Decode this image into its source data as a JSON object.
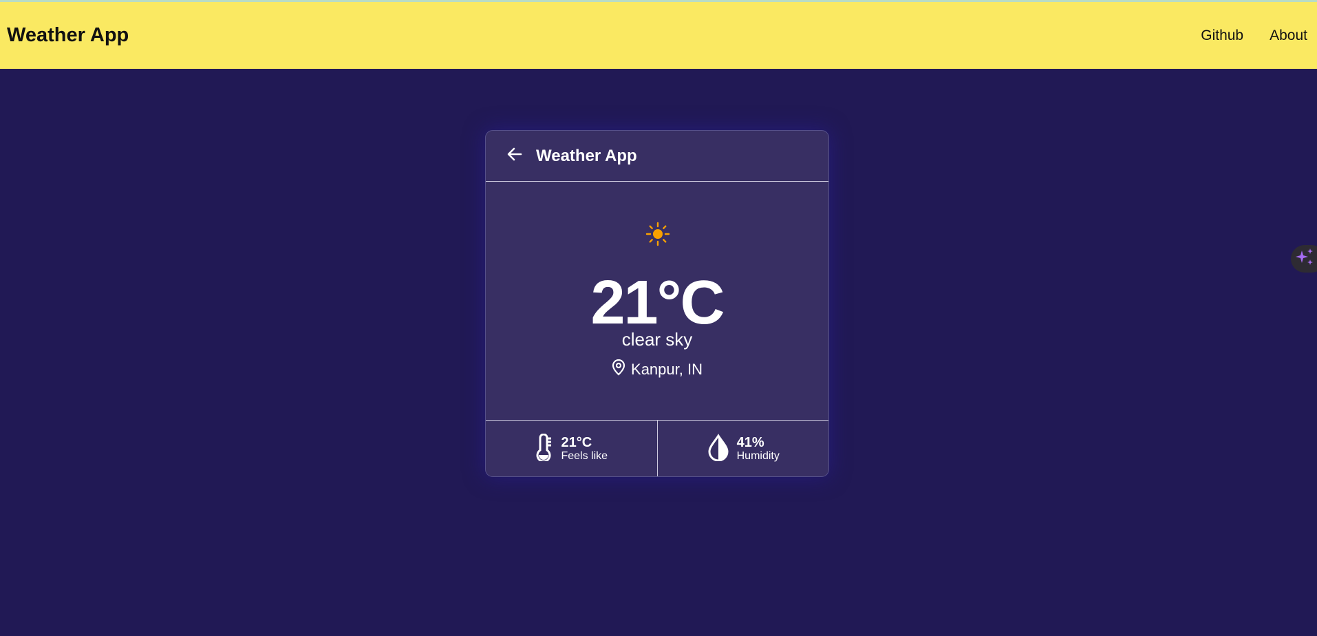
{
  "navbar": {
    "title": "Weather App",
    "links": [
      "Github",
      "About"
    ]
  },
  "card": {
    "header_title": "Weather App",
    "icon": "sun-icon",
    "temperature": "21°C",
    "description": "clear sky",
    "location": "Kanpur, IN",
    "feels_like": {
      "value": "21°C",
      "label": "Feels like"
    },
    "humidity": {
      "value": "41%",
      "label": "Humidity"
    }
  },
  "colors": {
    "navbar": "#fae962",
    "background": "#211955",
    "card": "#382f63",
    "sun": "#f9a100",
    "sparkle": "#a66cf2"
  }
}
